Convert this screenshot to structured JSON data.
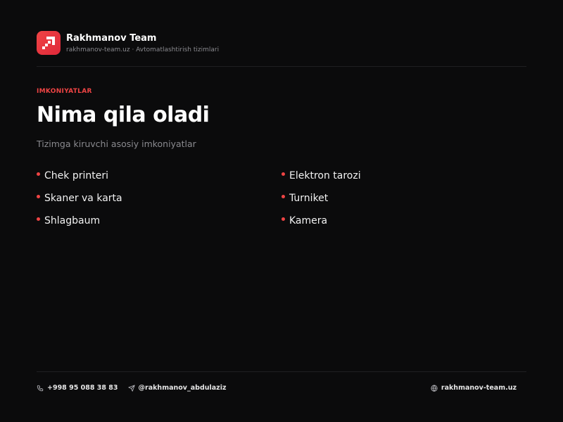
{
  "brand": {
    "name": "Rakhmanov Team",
    "subtitle": "rakhmanov-team.uz · Avtomatlashtirish tizimlari",
    "accent": "#ef4444"
  },
  "section": {
    "eyebrow": "IMKONIYATLAR",
    "title": "Nima qila oladi",
    "subtitle": "Tizimga kiruvchi asosiy imkoniyatlar"
  },
  "features": [
    {
      "label": "Chek printeri"
    },
    {
      "label": "Elektron tarozi"
    },
    {
      "label": "Skaner va karta"
    },
    {
      "label": "Turniket"
    },
    {
      "label": "Shlagbaum"
    },
    {
      "label": "Kamera"
    }
  ],
  "footer": {
    "phone": "+998 95 088 38 83",
    "phone_icon": "phone-icon",
    "telegram": "@rakhmanov_abdulaziz",
    "telegram_icon": "send-icon",
    "website": "rakhmanov-team.uz",
    "website_icon": "globe-icon"
  }
}
